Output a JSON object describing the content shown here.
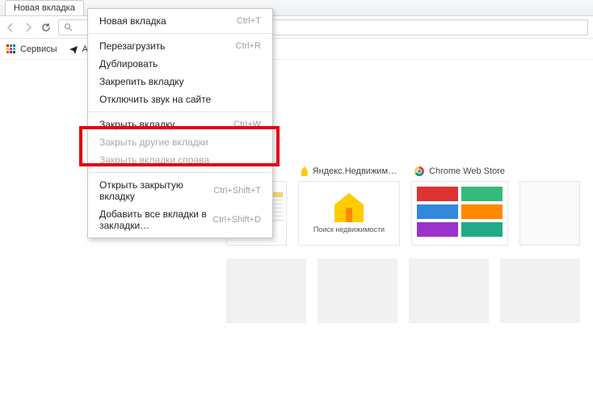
{
  "tab": {
    "title": "Новая вкладка"
  },
  "bookmarks": {
    "services": "Сервисы",
    "avia": "Ави"
  },
  "menu": {
    "new_tab": {
      "label": "Новая вкладка",
      "shortcut": "Ctrl+T"
    },
    "reload": {
      "label": "Перезагрузить",
      "shortcut": "Ctrl+R"
    },
    "duplicate": {
      "label": "Дублировать",
      "shortcut": ""
    },
    "pin": {
      "label": "Закрепить вкладку",
      "shortcut": ""
    },
    "mute": {
      "label": "Отключить звук на сайте",
      "shortcut": ""
    },
    "close": {
      "label": "Закрыть вкладку",
      "shortcut": "Ctrl+W"
    },
    "close_others": {
      "label": "Закрыть другие вкладки",
      "shortcut": ""
    },
    "close_right": {
      "label": "Закрыть вкладки справа",
      "shortcut": ""
    },
    "reopen": {
      "label": "Открыть закрытую вкладку",
      "shortcut": "Ctrl+Shift+T"
    },
    "bookmark_all": {
      "label": "Добавить все вкладки в закладки…",
      "shortcut": "Ctrl+Shift+D"
    }
  },
  "thumbs": {
    "yandex_realty": {
      "title": "Яндекс.Недвижим…",
      "caption": "Поиск недвижимости"
    },
    "chrome_store": {
      "title": "Chrome Web Store"
    }
  }
}
